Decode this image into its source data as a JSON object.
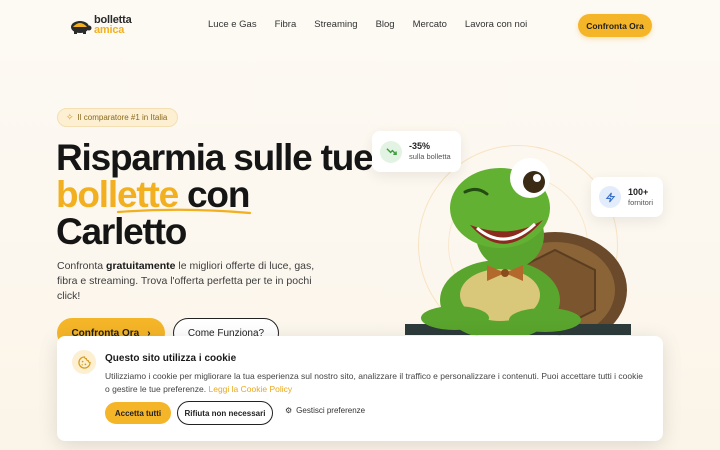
{
  "brand": {
    "line1": "bolletta",
    "line2": "amica",
    "colors": {
      "accent": "#f5b528",
      "dark": "#1f1f1f",
      "green": "#5aa52d"
    }
  },
  "nav": {
    "items": [
      "Luce e Gas",
      "Fibra",
      "Streaming",
      "Blog",
      "Mercato",
      "Lavora con noi"
    ],
    "cta_label": "Confronta Ora"
  },
  "hero": {
    "badge": "Il comparatore #1 in Italia",
    "badge_icon": "sparkle-icon",
    "title_before": "Risparmia sulle tue ",
    "title_accent": "bollette",
    "title_after": " con Carletto",
    "sub_before": "Confronta ",
    "sub_bold": "gratuitamente",
    "sub_after": " le migliori offerte di luce, gas, fibra e streaming. Trova l'offerta perfetta per te in pochi click!",
    "primary_label": "Confronta Ora",
    "primary_icon": "chevron-right-icon",
    "secondary_label": "Come Funziona?"
  },
  "stats": [
    {
      "value": "-35%",
      "label": "sulla bolletta",
      "icon": "trend-down-icon"
    },
    {
      "value": "100+",
      "label": "fornitori",
      "icon": "lightning-icon"
    }
  ],
  "cookie": {
    "title": "Questo sito utilizza i cookie",
    "text": "Utilizziamo i cookie per migliorare la tua esperienza sul nostro sito, analizzare il traffico e personalizzare i contenuti. Puoi accettare tutti i cookie o gestire le tue preferenze. ",
    "link": "Leggi la Cookie Policy",
    "accept": "Accetta tutti",
    "reject": "Rifiuta non necessari",
    "prefs": "Gestisci preferenze",
    "prefs_icon": "gear-icon",
    "icon": "cookie-icon"
  }
}
